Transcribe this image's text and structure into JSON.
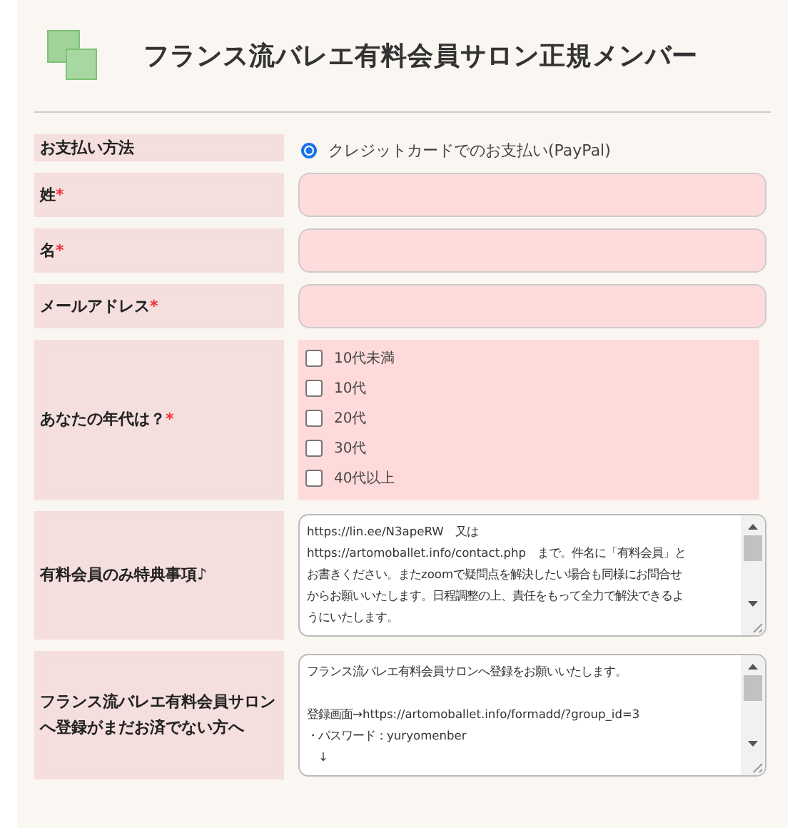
{
  "header": {
    "title": "フランス流バレエ有料会員サロン正規メンバー"
  },
  "rows": [
    {
      "kind": "radio",
      "label": "お支払い方法",
      "options": [
        {
          "label": "クレジットカードでのお支払い(PayPal)",
          "selected": true
        }
      ]
    },
    {
      "kind": "text",
      "label": "姓",
      "mark": "*"
    },
    {
      "kind": "text",
      "label": "名",
      "mark": "*"
    },
    {
      "kind": "text",
      "label": "メールアドレス",
      "mark": "*"
    },
    {
      "kind": "checkbox",
      "label": "あなたの年代は？",
      "mark": "*",
      "options": [
        {
          "label": "10代未満",
          "checked": false
        },
        {
          "label": "10代",
          "checked": false
        },
        {
          "label": "20代",
          "checked": false
        },
        {
          "label": "30代",
          "checked": false
        },
        {
          "label": "40代以上",
          "checked": false
        }
      ]
    },
    {
      "kind": "textarea",
      "label": "有料会員のみ特典事項♪",
      "paragraphs": [
        [
          "https://lin.ee/N3apeRW　又は",
          "https://artomoballet.info/contact.php　まで。件名に「有料会員」と",
          "お書きください。またzoomで疑問点を解決したい場合も同様にお問合せ",
          "からお願いいたします。日程調整の上、責任をもって全力で解決できるよ",
          "うにいたします。"
        ]
      ]
    },
    {
      "kind": "textarea",
      "label": "フランス流バレエ有料会員サロンへ登録がまだお済でない方へ",
      "paragraphs": [
        [
          "フランス流バレエ有料会員サロンへ登録をお願いいたします。"
        ],
        [
          "登録画面→https://artomoballet.info/formadd/?group_id=3",
          "・パスワード：yuryomenber",
          "　↓"
        ]
      ]
    }
  ]
}
